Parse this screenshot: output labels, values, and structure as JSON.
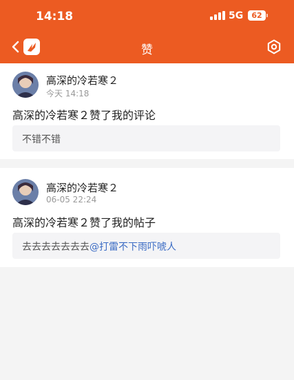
{
  "status_bar": {
    "time": "14:18",
    "network": "5G",
    "battery": "62"
  },
  "header": {
    "title": "赞"
  },
  "notifications": [
    {
      "user_name": "高深的冷若寒２",
      "time": "今天 14:18",
      "action": "高深的冷若寒２赞了我的评论",
      "quote_text": "不错不错",
      "quote_mention": ""
    },
    {
      "user_name": "高深的冷若寒２",
      "time": "06-05 22:24",
      "action": "高深的冷若寒２赞了我的帖子",
      "quote_text": "去去去去去去去",
      "quote_mention": "@打雷不下雨吓唬人"
    }
  ],
  "colors": {
    "accent": "#ec5b22",
    "mention": "#3a6bc4"
  }
}
